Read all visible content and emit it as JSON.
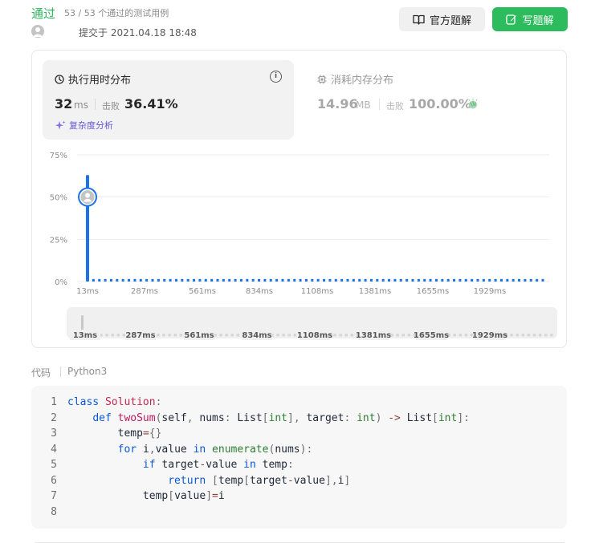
{
  "header": {
    "status": "通过",
    "tests": "53 / 53 个通过的测试用例",
    "submitted": "提交于 2021.04.18 18:48",
    "btn_official": "官方题解",
    "btn_write": "写题解"
  },
  "runtime": {
    "title": "执行用时分布",
    "value": "32",
    "unit": "ms",
    "beats_label": "击败",
    "beats": "36.41%",
    "complexity_link": "复杂度分析"
  },
  "memory": {
    "title": "消耗内存分布",
    "value": "14.96",
    "unit": "MB",
    "beats_label": "击败",
    "beats": "100.00%"
  },
  "chart_data": {
    "type": "bar",
    "y_ticks": [
      "75%",
      "50%",
      "25%",
      "0%"
    ],
    "ylim": [
      0,
      75
    ],
    "x_ticks": [
      "13ms",
      "287ms",
      "561ms",
      "834ms",
      "1108ms",
      "1381ms",
      "1655ms",
      "1929ms"
    ],
    "peak": {
      "x": "13ms",
      "value": 63
    },
    "highlight_x": "13ms",
    "highlight_value": 50,
    "baseline_value": 1.5,
    "baseline_count": 78,
    "minimap_ticks": [
      "13ms",
      "287ms",
      "561ms",
      "834ms",
      "1108ms",
      "1381ms",
      "1655ms",
      "1929ms"
    ],
    "bar_color": "#1a73e8"
  },
  "code": {
    "label": "代码",
    "language": "Python3",
    "line_numbers": [
      "1",
      "2",
      "3",
      "4",
      "5",
      "6",
      "7",
      "8"
    ],
    "lines": [
      [
        [
          "kw",
          "class"
        ],
        [
          "sp",
          " "
        ],
        [
          "cls",
          "Solution"
        ],
        [
          "pu",
          ":"
        ]
      ],
      [
        [
          "sp",
          "    "
        ],
        [
          "kw",
          "def"
        ],
        [
          "sp",
          " "
        ],
        [
          "fn",
          "twoSum"
        ],
        [
          "pu",
          "("
        ],
        [
          "id",
          "self"
        ],
        [
          "pu",
          ","
        ],
        [
          "sp",
          " "
        ],
        [
          "id",
          "nums"
        ],
        [
          "pu",
          ":"
        ],
        [
          "sp",
          " "
        ],
        [
          "id",
          "List"
        ],
        [
          "pu",
          "["
        ],
        [
          "typ",
          "int"
        ],
        [
          "pu",
          "]"
        ],
        [
          "pu",
          ","
        ],
        [
          "sp",
          " "
        ],
        [
          "id",
          "target"
        ],
        [
          "pu",
          ":"
        ],
        [
          "sp",
          " "
        ],
        [
          "typ",
          "int"
        ],
        [
          "pu",
          ")"
        ],
        [
          "sp",
          " "
        ],
        [
          "op",
          "->"
        ],
        [
          "sp",
          " "
        ],
        [
          "id",
          "List"
        ],
        [
          "pu",
          "["
        ],
        [
          "typ",
          "int"
        ],
        [
          "pu",
          "]"
        ],
        [
          "pu",
          ":"
        ]
      ],
      [
        [
          "sp",
          "        "
        ],
        [
          "id",
          "temp"
        ],
        [
          "op",
          "="
        ],
        [
          "pu",
          "{}"
        ]
      ],
      [
        [
          "sp",
          "        "
        ],
        [
          "kw",
          "for"
        ],
        [
          "sp",
          " "
        ],
        [
          "id",
          "i"
        ],
        [
          "pu",
          ","
        ],
        [
          "id",
          "value"
        ],
        [
          "sp",
          " "
        ],
        [
          "kw",
          "in"
        ],
        [
          "sp",
          " "
        ],
        [
          "bi",
          "enumerate"
        ],
        [
          "pu",
          "("
        ],
        [
          "id",
          "nums"
        ],
        [
          "pu",
          "):"
        ]
      ],
      [
        [
          "sp",
          "            "
        ],
        [
          "kw",
          "if"
        ],
        [
          "sp",
          " "
        ],
        [
          "id",
          "target"
        ],
        [
          "op",
          "-"
        ],
        [
          "id",
          "value"
        ],
        [
          "sp",
          " "
        ],
        [
          "kw",
          "in"
        ],
        [
          "sp",
          " "
        ],
        [
          "id",
          "temp"
        ],
        [
          "pu",
          ":"
        ]
      ],
      [
        [
          "sp",
          "                "
        ],
        [
          "kw",
          "return"
        ],
        [
          "sp",
          " "
        ],
        [
          "pu",
          "["
        ],
        [
          "id",
          "temp"
        ],
        [
          "pu",
          "["
        ],
        [
          "id",
          "target"
        ],
        [
          "op",
          "-"
        ],
        [
          "id",
          "value"
        ],
        [
          "pu",
          "],"
        ],
        [
          "id",
          "i"
        ],
        [
          "pu",
          "]"
        ]
      ],
      [
        [
          "sp",
          "            "
        ],
        [
          "id",
          "temp"
        ],
        [
          "pu",
          "["
        ],
        [
          "id",
          "value"
        ],
        [
          "pu",
          "]"
        ],
        [
          "op",
          "="
        ],
        [
          "id",
          "i"
        ]
      ],
      []
    ]
  }
}
